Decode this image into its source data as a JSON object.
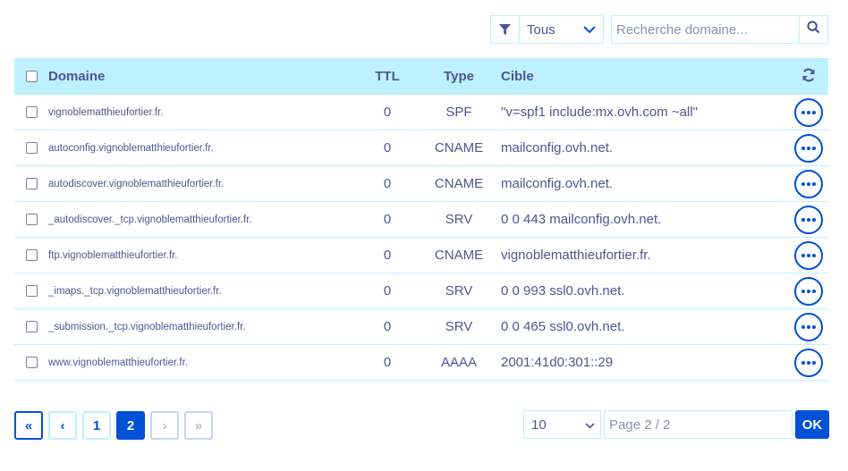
{
  "toolbar": {
    "filter_icon": "filter-icon",
    "filter_value": "Tous",
    "search_placeholder": "Recherche domaine..."
  },
  "table": {
    "headers": {
      "domain": "Domaine",
      "ttl": "TTL",
      "type": "Type",
      "target": "Cible"
    },
    "rows": [
      {
        "domain": "vignoblematthieufortier.fr.",
        "ttl": "0",
        "type": "SPF",
        "target": "\"v=spf1 include:mx.ovh.com ~all\""
      },
      {
        "domain": "autoconfig.vignoblematthieufortier.fr.",
        "ttl": "0",
        "type": "CNAME",
        "target": "mailconfig.ovh.net."
      },
      {
        "domain": "autodiscover.vignoblematthieufortier.fr.",
        "ttl": "0",
        "type": "CNAME",
        "target": "mailconfig.ovh.net."
      },
      {
        "domain": "_autodiscover._tcp.vignoblematthieufortier.fr.",
        "ttl": "0",
        "type": "SRV",
        "target": "0 0 443 mailconfig.ovh.net."
      },
      {
        "domain": "ftp.vignoblematthieufortier.fr.",
        "ttl": "0",
        "type": "CNAME",
        "target": "vignoblematthieufortier.fr."
      },
      {
        "domain": "_imaps._tcp.vignoblematthieufortier.fr.",
        "ttl": "0",
        "type": "SRV",
        "target": "0 0 993 ssl0.ovh.net."
      },
      {
        "domain": "_submission._tcp.vignoblematthieufortier.fr.",
        "ttl": "0",
        "type": "SRV",
        "target": "0 0 465 ssl0.ovh.net."
      },
      {
        "domain": "www.vignoblematthieufortier.fr.",
        "ttl": "0",
        "type": "AAAA",
        "target": "2001:41d0:301::29"
      }
    ]
  },
  "pagination": {
    "first": "«",
    "prev": "‹",
    "pages": [
      "1",
      "2"
    ],
    "current": "2",
    "next": "›",
    "last": "»",
    "page_size": "10",
    "page_input_placeholder": "Page 2 / 2",
    "ok_label": "OK"
  },
  "colors": {
    "accent": "#0050d7",
    "header_bg": "#bef1ff",
    "text": "#4d5693"
  }
}
